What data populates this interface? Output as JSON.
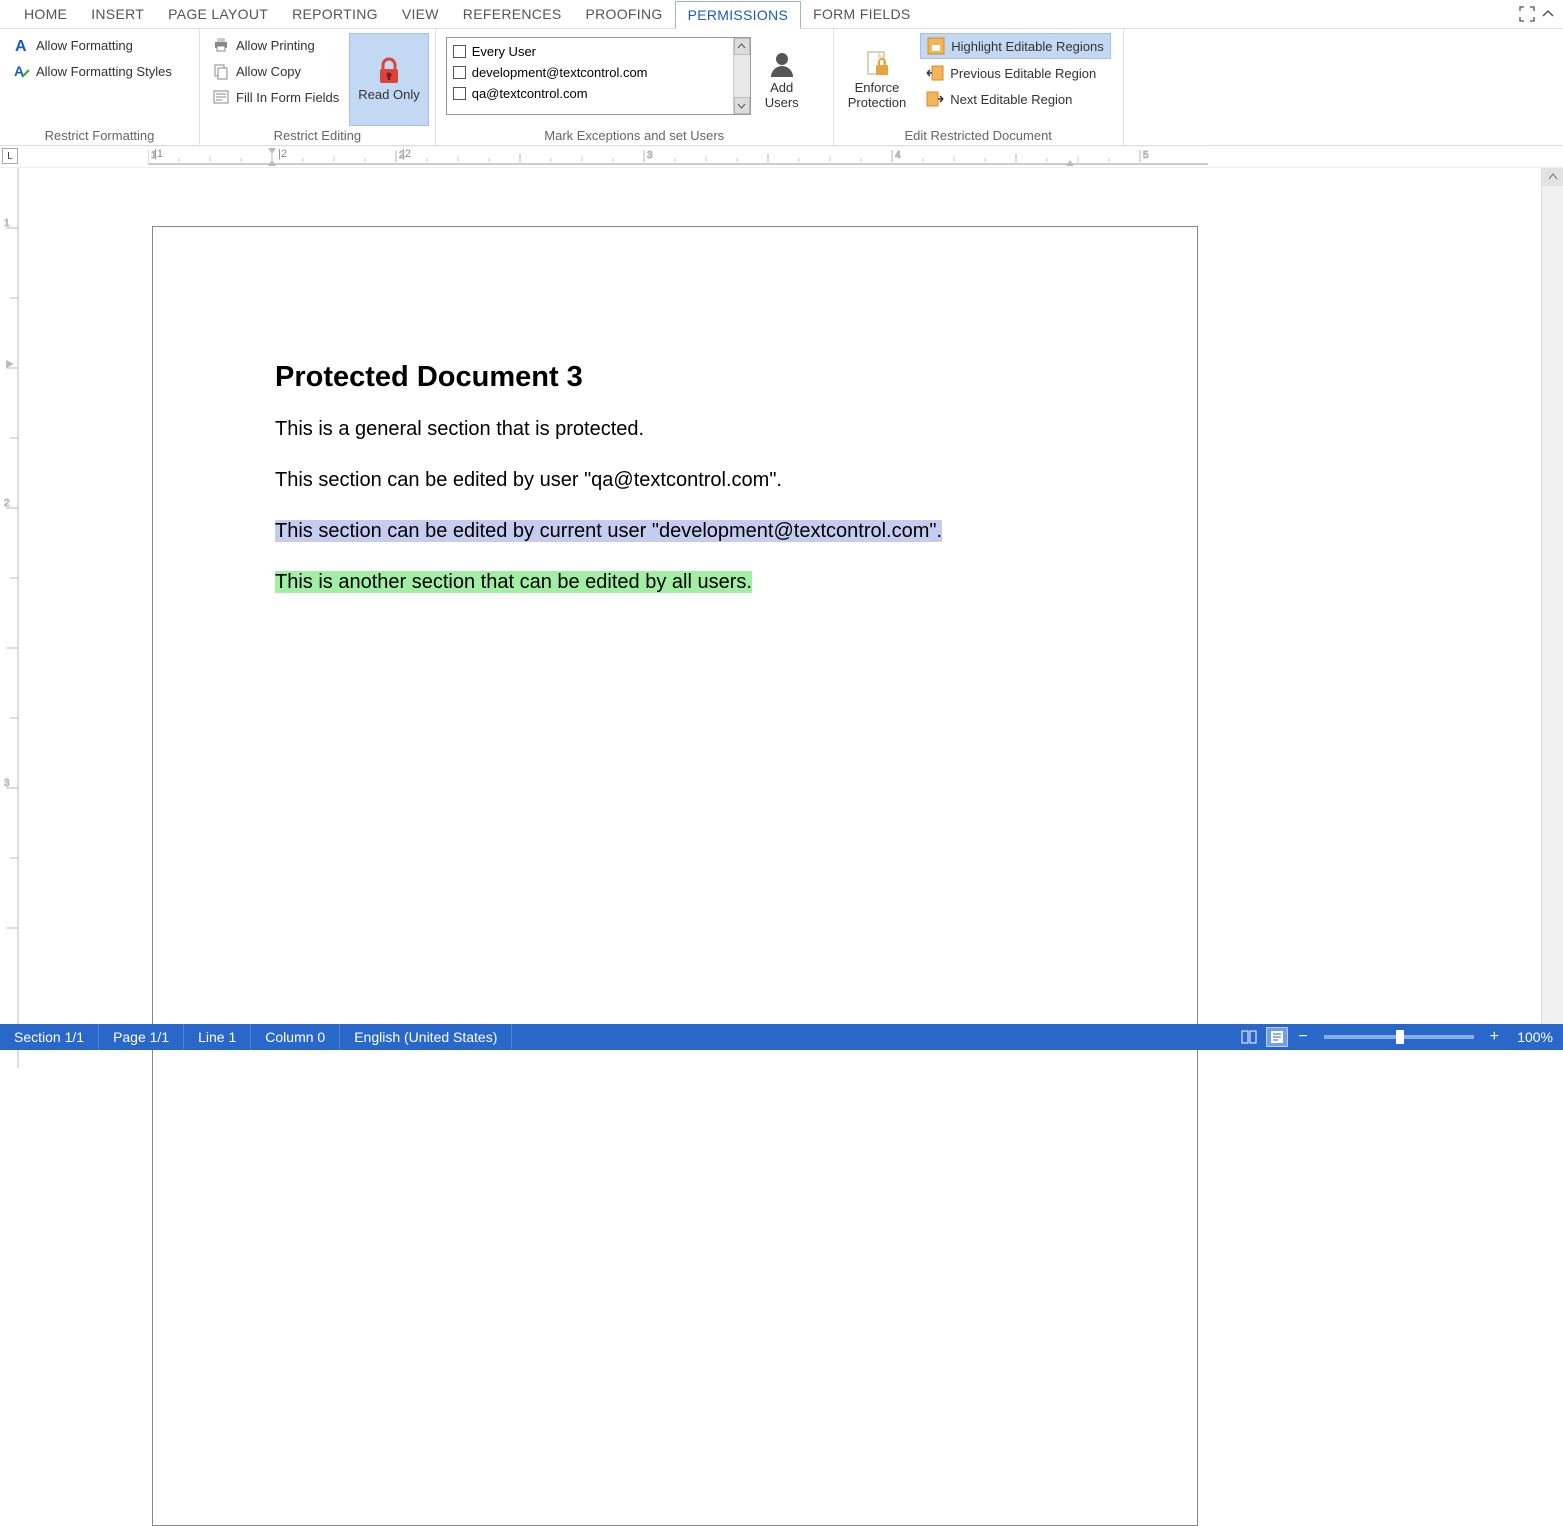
{
  "menu": {
    "tabs": [
      "HOME",
      "INSERT",
      "PAGE LAYOUT",
      "REPORTING",
      "VIEW",
      "REFERENCES",
      "PROOFING",
      "PERMISSIONS",
      "FORM FIELDS"
    ],
    "active": 7
  },
  "ribbon": {
    "restrict_formatting": {
      "label": "Restrict Formatting",
      "allow_formatting": "Allow Formatting",
      "allow_formatting_styles": "Allow Formatting Styles"
    },
    "restrict_editing": {
      "label": "Restrict Editing",
      "allow_printing": "Allow Printing",
      "allow_copy": "Allow Copy",
      "fill_in_form_fields": "Fill In Form Fields",
      "read_only": "Read Only"
    },
    "mark_exceptions": {
      "label": "Mark Exceptions and set Users",
      "users": [
        "Every User",
        "development@textcontrol.com",
        "qa@textcontrol.com"
      ],
      "add_users": "Add Users"
    },
    "edit_restricted": {
      "label": "Edit Restricted Document",
      "enforce_protection": "Enforce Protection",
      "highlight_regions": "Highlight Editable Regions",
      "previous_region": "Previous Editable Region",
      "next_region": "Next Editable Region"
    }
  },
  "document": {
    "title": "Protected Document 3",
    "p1": "This is a general section that is protected.",
    "p2": "This section can be edited by user \"qa@textcontrol.com\".",
    "p3": "This section can be edited by current user \"development@textcontrol.com\".",
    "p4": "This is another section that can be edited by all users."
  },
  "status": {
    "section": "Section 1/1",
    "page": "Page 1/1",
    "line": "Line 1",
    "column": "Column 0",
    "language": "English (United States)",
    "zoom": "100%"
  }
}
